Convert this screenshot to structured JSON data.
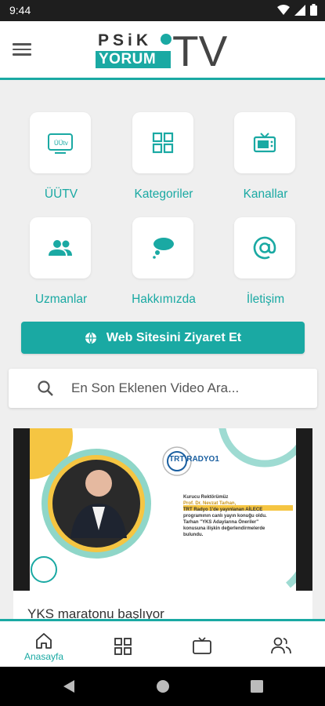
{
  "status": {
    "time": "9:44"
  },
  "header": {
    "logo_top": "PSiK",
    "logo_bottom": "YORUM",
    "logo_suffix": "TV"
  },
  "grid": [
    {
      "label": "ÜÜTV",
      "icon": "uutv-tv-icon"
    },
    {
      "label": "Kategoriler",
      "icon": "grid-icon"
    },
    {
      "label": "Kanallar",
      "icon": "tv-icon"
    },
    {
      "label": "Uzmanlar",
      "icon": "people-icon"
    },
    {
      "label": "Hakkımızda",
      "icon": "thought-bubble-icon"
    },
    {
      "label": "İletişim",
      "icon": "at-icon"
    }
  ],
  "web_button": {
    "label": "Web Sitesini Ziyaret Et"
  },
  "search": {
    "placeholder": "En Son Eklenen Video Ara..."
  },
  "video": {
    "title": "YKS maratonu başlıyor",
    "thumb": {
      "brand": "TRT RADYO1",
      "line1": "Kurucu Rektörümüz",
      "name": "Prof. Dr. Nevzat Tarhan,",
      "line2": "TRT Radyo 1'de yayınlanan AİLECE",
      "line3": "programının canlı yayın konuğu oldu.",
      "line4": "Tarhan \"YKS Adaylarına Öneriler\"",
      "line5": "konusuna ilişkin değerlendirmelerde",
      "line6": "bulundu."
    }
  },
  "bottom_nav": [
    {
      "label": "Anasayfa",
      "icon": "home-icon"
    },
    {
      "label": "",
      "icon": "grid-icon"
    },
    {
      "label": "",
      "icon": "tv-icon"
    },
    {
      "label": "",
      "icon": "people-icon"
    }
  ],
  "colors": {
    "accent": "#1aa9a3"
  }
}
